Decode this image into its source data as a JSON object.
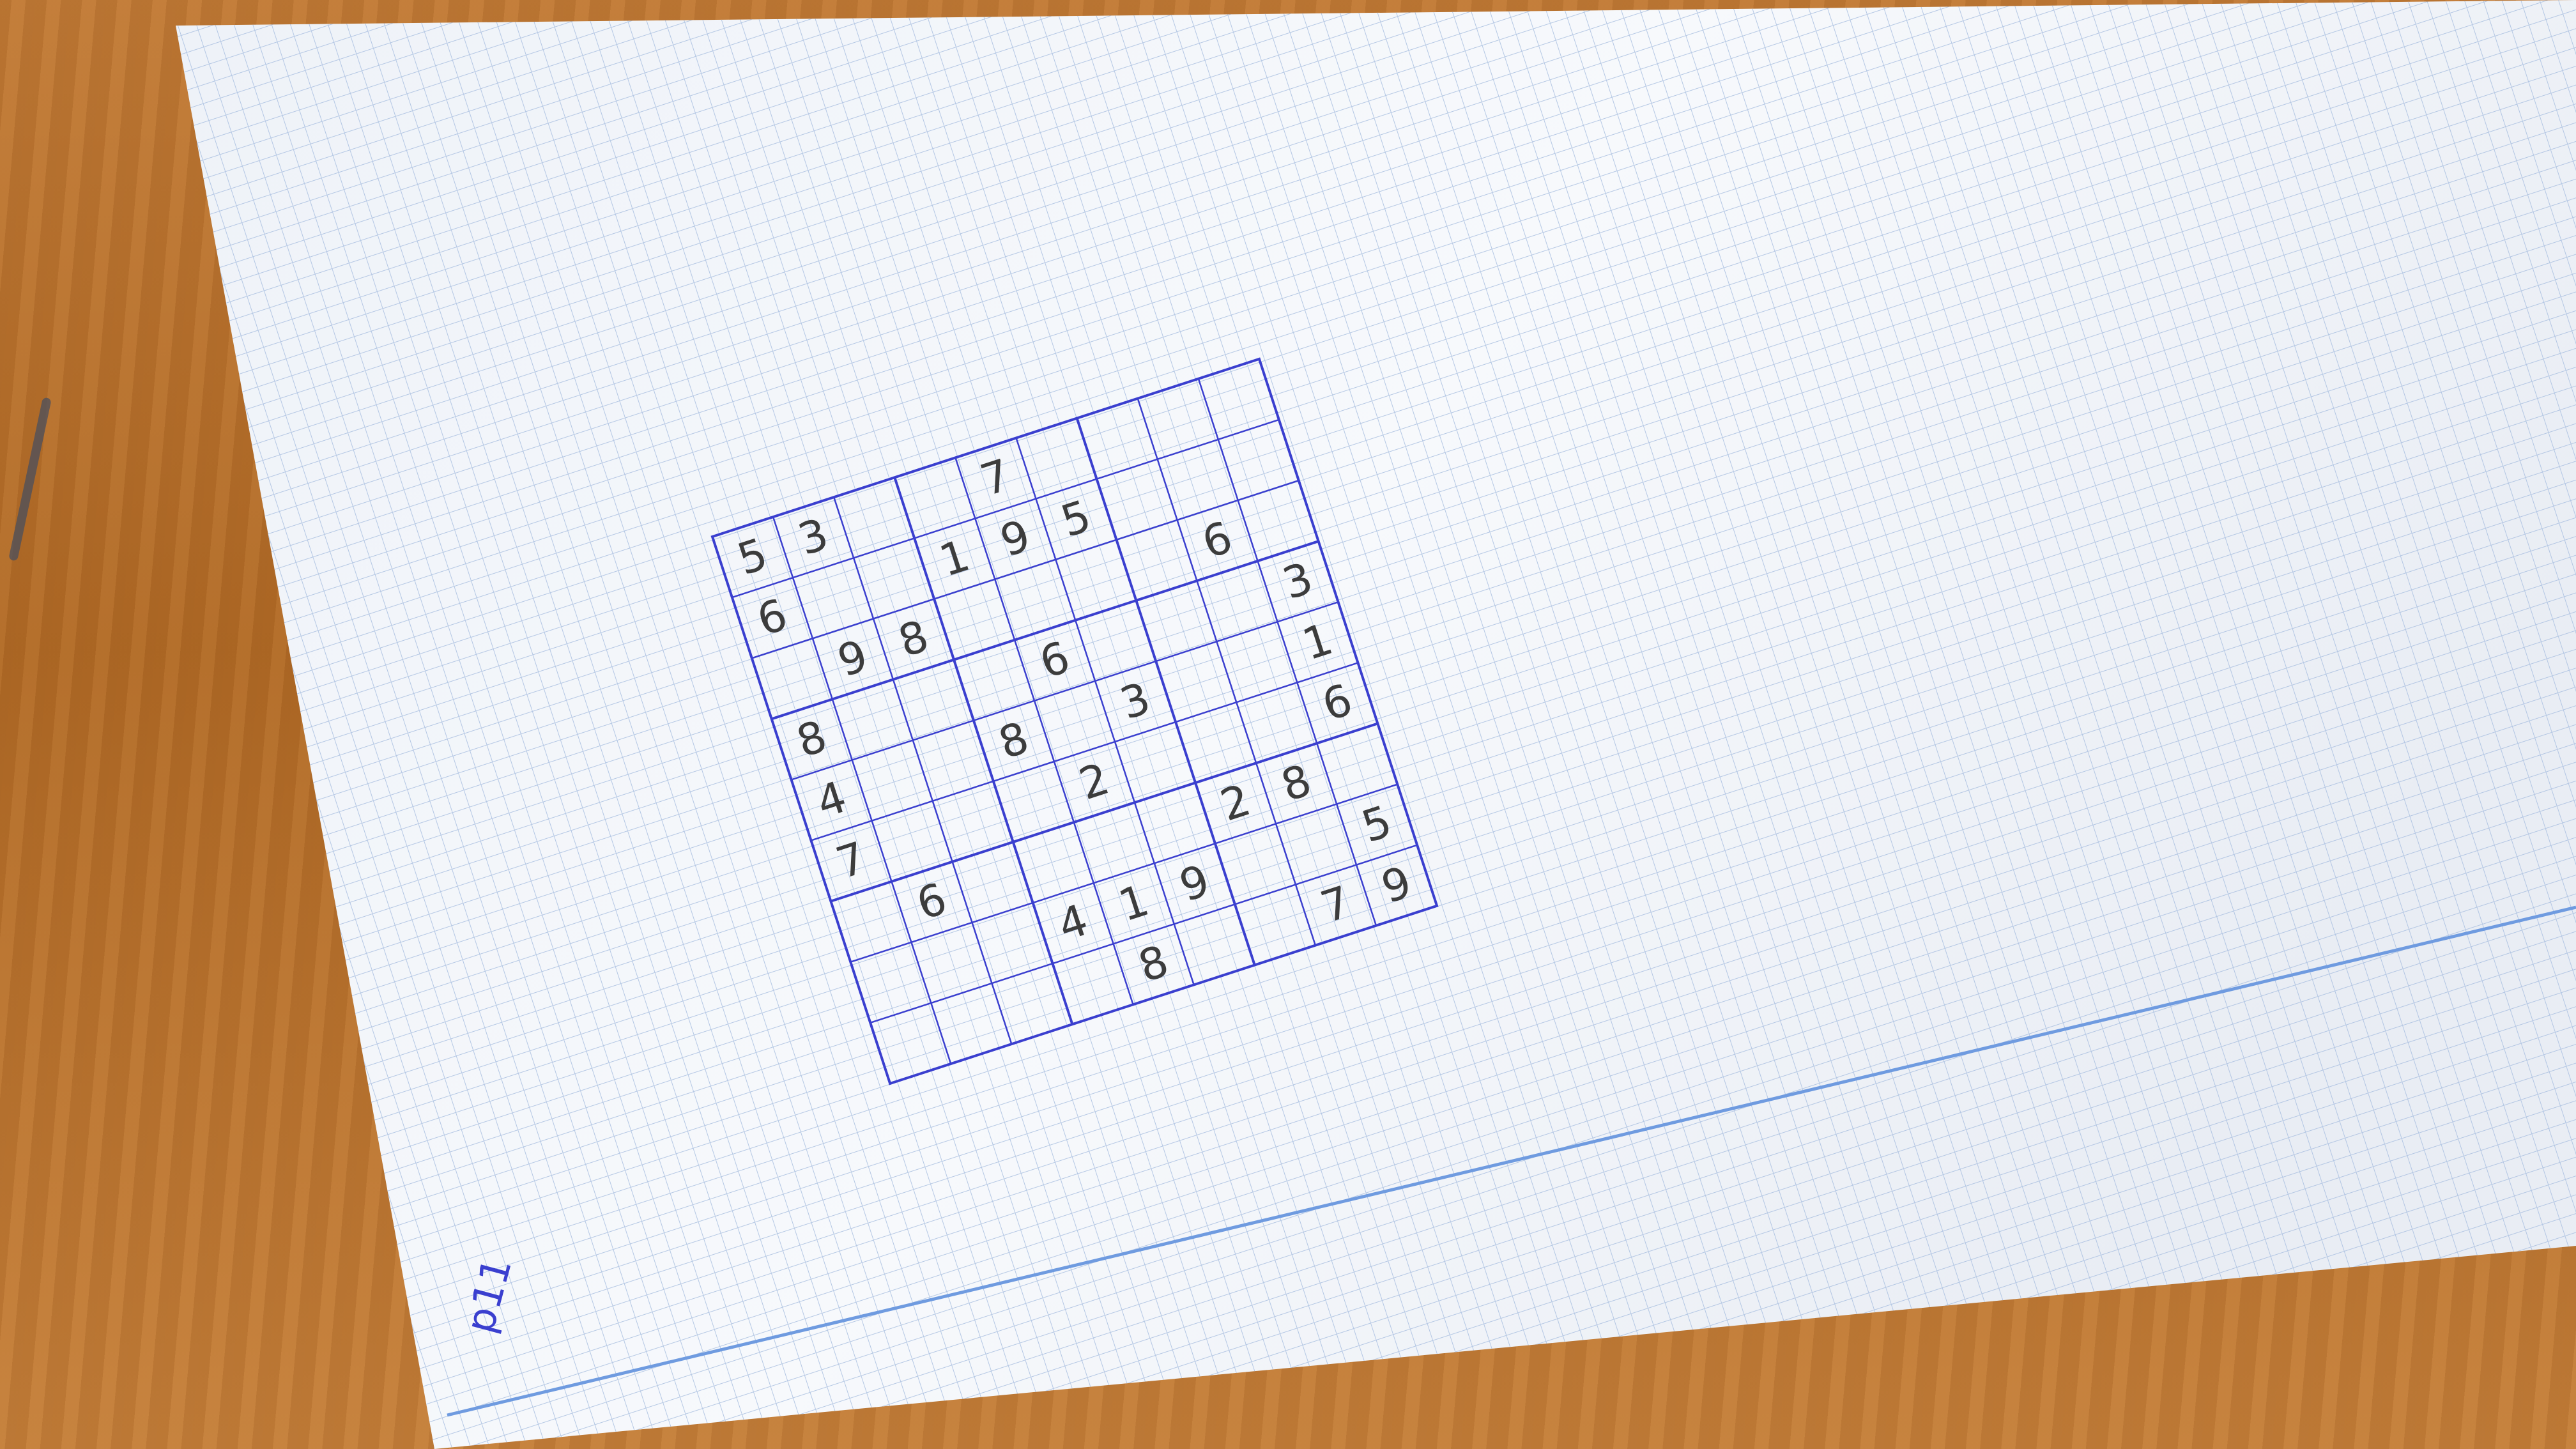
{
  "scene": {
    "colors": {
      "desk": "#b8702e",
      "paper": "#f4f7fb",
      "paper_grid": "#a9bfe0",
      "ink_blue": "#3a3fcf",
      "pencil": "#3c3c3c",
      "margin_line": "#6f9be0"
    },
    "note": {
      "text": "p11"
    }
  },
  "sudoku": {
    "size": 9,
    "cells": [
      [
        "5",
        "3",
        "",
        "",
        "7",
        "",
        "",
        "",
        ""
      ],
      [
        "6",
        "",
        "",
        "1",
        "9",
        "5",
        "",
        "",
        ""
      ],
      [
        "",
        "9",
        "8",
        "",
        "",
        "",
        "",
        "6",
        ""
      ],
      [
        "8",
        "",
        "",
        "",
        "6",
        "",
        "",
        "",
        "3"
      ],
      [
        "4",
        "",
        "",
        "8",
        "",
        "3",
        "",
        "",
        "1"
      ],
      [
        "7",
        "",
        "",
        "",
        "2",
        "",
        "",
        "",
        "6"
      ],
      [
        "",
        "6",
        "",
        "",
        "",
        "",
        "2",
        "8",
        ""
      ],
      [
        "",
        "",
        "",
        "4",
        "1",
        "9",
        "",
        "",
        "5"
      ],
      [
        "",
        "",
        "",
        "",
        "8",
        "",
        "",
        "7",
        "9"
      ]
    ]
  }
}
